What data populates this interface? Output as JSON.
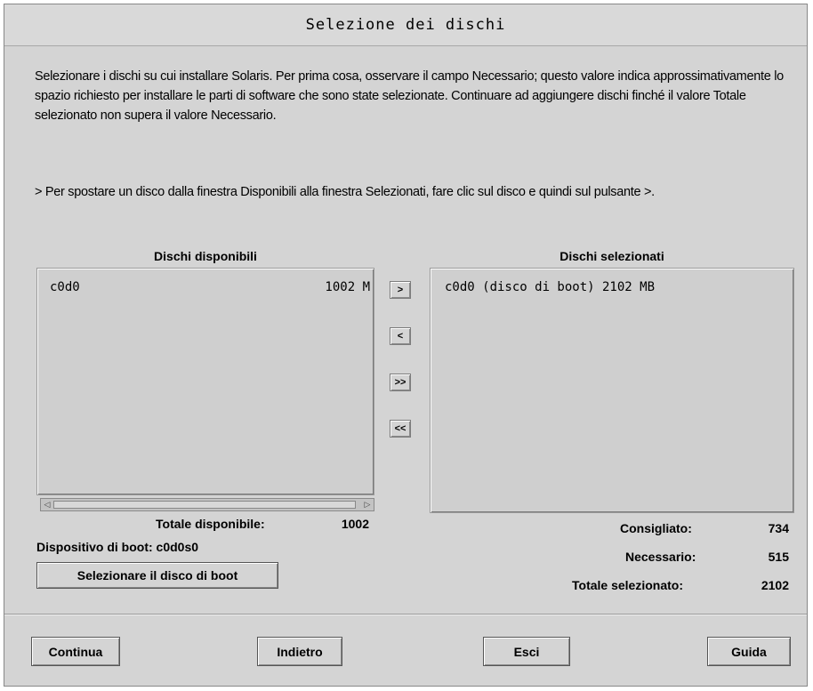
{
  "window": {
    "title": "Selezione dei dischi"
  },
  "instructions": {
    "paragraph1": "Selezionare i dischi su cui installare Solaris. Per prima cosa, osservare il campo Necessario; questo valore indica approssimativamente lo spazio richiesto per installare le parti di software che sono state selezionate. Continuare ad aggiungere dischi finché il valore Totale selezionato non supera il valore Necessario.",
    "paragraph2": "> Per spostare un disco dalla finestra Disponibili alla finestra Selezionati, fare clic sul disco e quindi sul pulsante >."
  },
  "available": {
    "title": "Dischi disponibili",
    "items": [
      {
        "name": "c0d0",
        "size": "1002 M"
      }
    ],
    "total_label": "Totale disponibile:",
    "total_value": "1002",
    "boot_device_label": "Dispositivo di boot: c0d0s0",
    "select_boot_button": "Selezionare il disco di boot"
  },
  "move_buttons": {
    "add": ">",
    "remove": "<",
    "add_all": ">>",
    "remove_all": "<<"
  },
  "selected": {
    "title": "Dischi selezionati",
    "items": [
      {
        "text": "c0d0 (disco di boot) 2102 MB"
      }
    ],
    "recommended_label": "Consigliato:",
    "recommended_value": "734",
    "required_label": "Necessario:",
    "required_value": "515",
    "total_label": "Totale selezionato:",
    "total_value": "2102"
  },
  "footer": {
    "continue": "Continua",
    "back": "Indietro",
    "exit": "Esci",
    "help": "Guida"
  }
}
